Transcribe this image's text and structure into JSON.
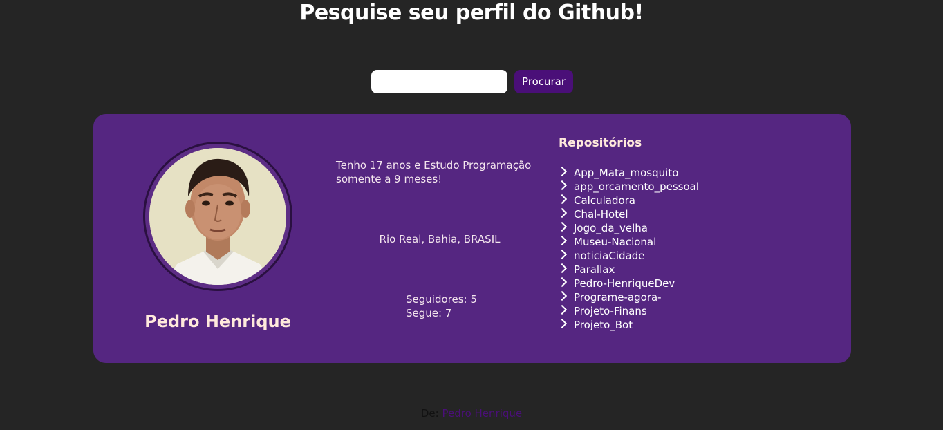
{
  "header": {
    "title": "Pesquise seu perfil do Github!"
  },
  "search": {
    "value": "",
    "placeholder": "",
    "button_label": "Procurar"
  },
  "profile": {
    "name": "Pedro Henrique",
    "bio": "Tenho 17 anos e Estudo Programação somente a 9 meses!",
    "location": "Rio Real, Bahia, BRASIL",
    "followers_label": "Seguidores: 5",
    "following_label": "Segue: 7"
  },
  "repositories": {
    "title": "Repositórios",
    "items": [
      "App_Mata_mosquito",
      "app_orcamento_pessoal",
      "Calculadora",
      "Chal-Hotel",
      "Jogo_da_velha",
      "Museu-Nacional",
      "noticiaCidade",
      "Parallax",
      "Pedro-HenriqueDev",
      "Programe-agora-",
      "Projeto-Finans",
      "Projeto_Bot"
    ],
    "icon": "chevron-right-icon"
  },
  "footer": {
    "prefix": "De:",
    "link_text": "Pedro Henrique"
  },
  "colors": {
    "background": "#252525",
    "card": "#552681",
    "button": "#4a0f78",
    "accent_text": "#ffe9dc"
  }
}
